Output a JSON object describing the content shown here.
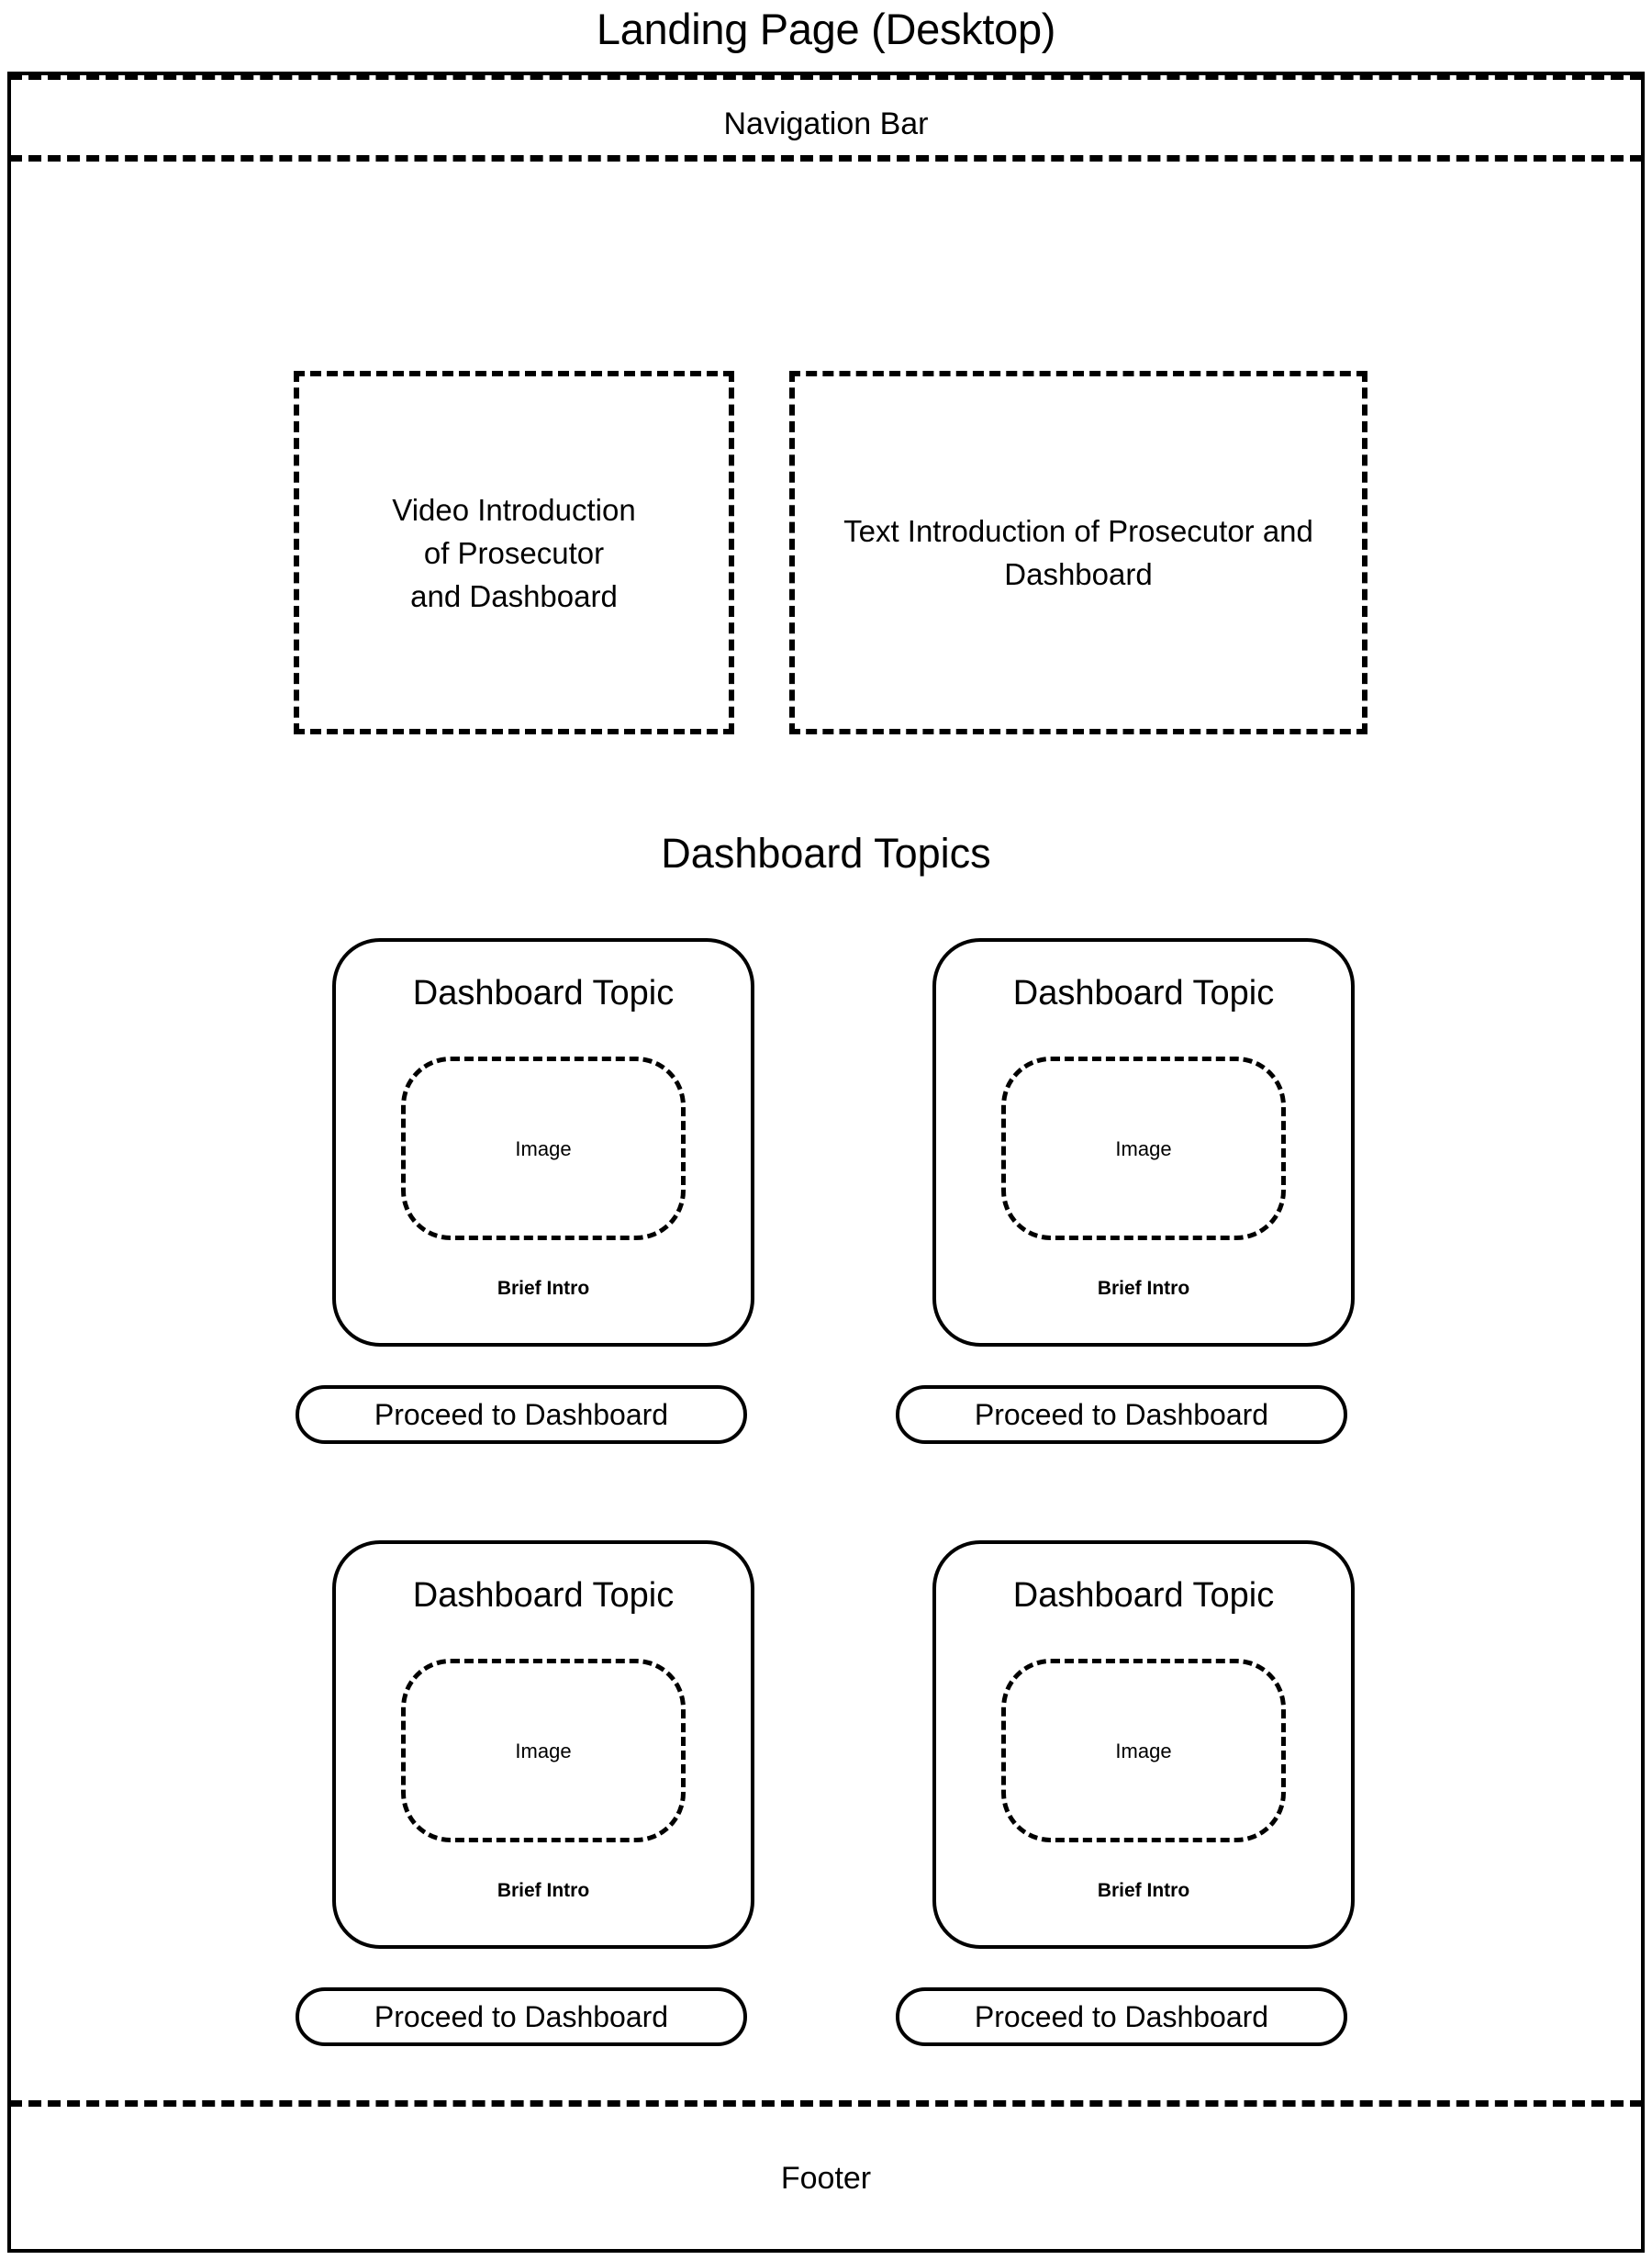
{
  "page": {
    "title": "Landing Page (Desktop)",
    "accent_color": "#000000",
    "background_color": "#ffffff"
  },
  "navigation": {
    "label": "Navigation Bar"
  },
  "intro": {
    "video_block": {
      "label": "Video Introduction\nof Prosecutor\nand Dashboard"
    },
    "text_block": {
      "label": "Text Introduction of Prosecutor and Dashboard"
    }
  },
  "topics_section": {
    "heading": "Dashboard Topics",
    "cards": [
      {
        "title": "Dashboard Topic",
        "image_label": "Image",
        "brief_intro": "Brief Intro",
        "button_label": "Proceed to Dashboard"
      },
      {
        "title": "Dashboard Topic",
        "image_label": "Image",
        "brief_intro": "Brief Intro",
        "button_label": "Proceed to Dashboard"
      },
      {
        "title": "Dashboard Topic",
        "image_label": "Image",
        "brief_intro": "Brief Intro",
        "button_label": "Proceed to Dashboard"
      },
      {
        "title": "Dashboard Topic",
        "image_label": "Image",
        "brief_intro": "Brief Intro",
        "button_label": "Proceed to Dashboard"
      }
    ]
  },
  "footer": {
    "label": "Footer"
  }
}
